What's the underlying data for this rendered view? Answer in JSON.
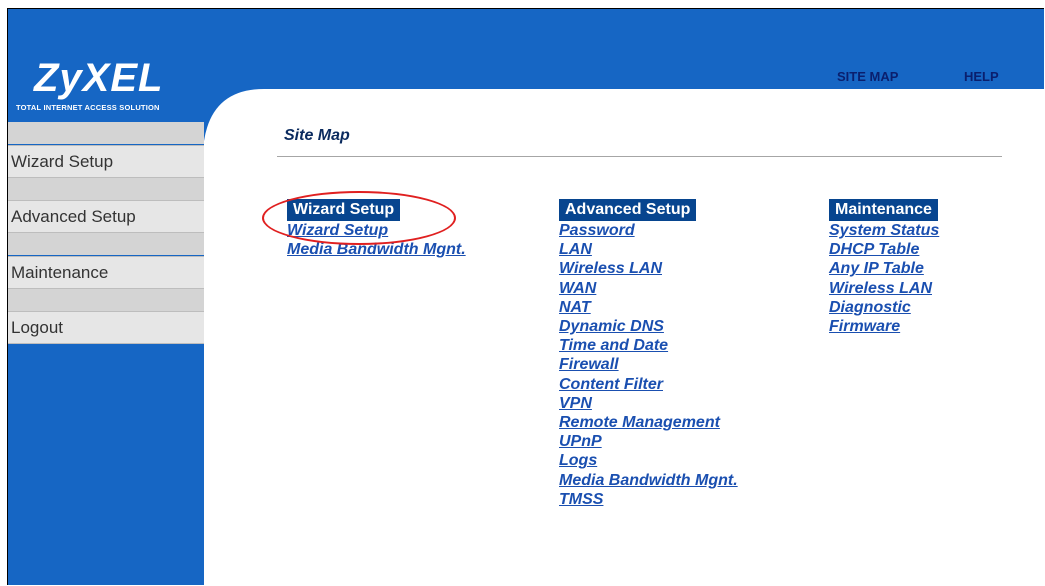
{
  "brand": {
    "logo": "ZyXEL",
    "tagline": "TOTAL INTERNET ACCESS SOLUTION"
  },
  "topnav": {
    "site_map": "SITE MAP",
    "help": "HELP"
  },
  "sidebar": {
    "items": [
      {
        "label": "Wizard Setup"
      },
      {
        "label": "Advanced Setup"
      },
      {
        "label": "Maintenance"
      },
      {
        "label": "Logout"
      }
    ]
  },
  "page": {
    "title": "Site Map"
  },
  "columns": [
    {
      "heading": "Wizard Setup",
      "links": [
        "Wizard Setup",
        "Media Bandwidth Mgnt."
      ]
    },
    {
      "heading": "Advanced Setup",
      "links": [
        "Password",
        "LAN",
        "Wireless LAN",
        "WAN",
        "NAT",
        "Dynamic DNS",
        "Time and Date",
        "Firewall",
        "Content Filter",
        "VPN",
        "Remote Management",
        "UPnP",
        "Logs",
        "Media Bandwidth Mgnt.",
        "TMSS"
      ]
    },
    {
      "heading": "Maintenance",
      "links": [
        "System Status",
        "DHCP Table",
        "Any IP Table",
        "Wireless LAN",
        "Diagnostic",
        "Firmware"
      ]
    }
  ],
  "colors": {
    "brand_blue": "#1666c4",
    "heading_bg": "#07458f",
    "link": "#1a4fb0",
    "callout": "#e02020"
  }
}
